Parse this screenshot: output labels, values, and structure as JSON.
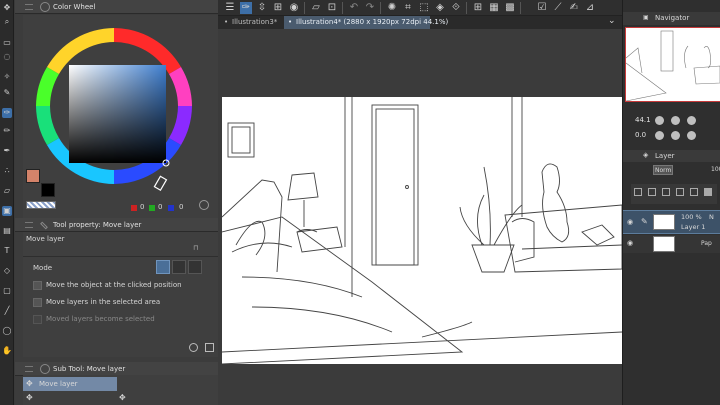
{
  "tools": {
    "icons": [
      "move-tool-icon",
      "select-tool-icon",
      "lasso-tool-icon",
      "magic-wand-icon",
      "eyedropper-icon",
      "pen-tool-icon",
      "pencil-tool-icon",
      "brush-tool-icon",
      "airbrush-icon",
      "decoration-icon",
      "eraser-icon",
      "fill-tool-icon",
      "gradient-icon",
      "text-tool-icon",
      "figure-tool-icon",
      "frame-tool-icon",
      "ruler-tool-icon",
      "balloon-tool-icon"
    ]
  },
  "color_wheel": {
    "title": "Color Wheel",
    "main_color": "#d4836a",
    "sub_color": "#000000",
    "r_value": "0",
    "g_value": "0",
    "b_value": "0"
  },
  "tool_property": {
    "title": "Tool property: Move layer",
    "tool_name": "Move layer",
    "mode_label": "Mode",
    "options": [
      {
        "label": "Move the object at the clicked position",
        "enabled": true
      },
      {
        "label": "Move layers in the selected area",
        "enabled": true
      },
      {
        "label": "Moved layers become selected",
        "enabled": false
      }
    ]
  },
  "sub_tool": {
    "title": "Sub Tool: Move layer",
    "items": [
      "Move layer"
    ]
  },
  "toolbar": {
    "icons": [
      "menu-icon",
      "pen-pressure-icon",
      "spinner-icon",
      "stamp-icon",
      "record-icon",
      "layer-icon",
      "snap-icon",
      "undo-icon",
      "redo-icon",
      "loading-icon",
      "crop-icon",
      "lasso-select-icon",
      "bucket-icon",
      "transform-icon",
      "grid-icon",
      "ruler-icon",
      "brush-snap-icon",
      "check-icon",
      "line-icon",
      "pen-line-icon"
    ]
  },
  "tabs": [
    {
      "label": "Illustration3*",
      "active": false
    },
    {
      "label": "Illustration4* (2880 x 1920px 72dpi 44.1%)",
      "active": true
    }
  ],
  "navigator": {
    "title": "Navigator",
    "zoom": "44.1",
    "rotation": "0.0"
  },
  "layer_panel": {
    "title": "Layer",
    "blend_mode": "Norm",
    "opacity_value": "100",
    "layers": [
      {
        "opacity": "100 %",
        "mode": "N",
        "name": "Layer 1"
      },
      {
        "opacity": "",
        "mode": "",
        "name": "Pap"
      }
    ]
  }
}
